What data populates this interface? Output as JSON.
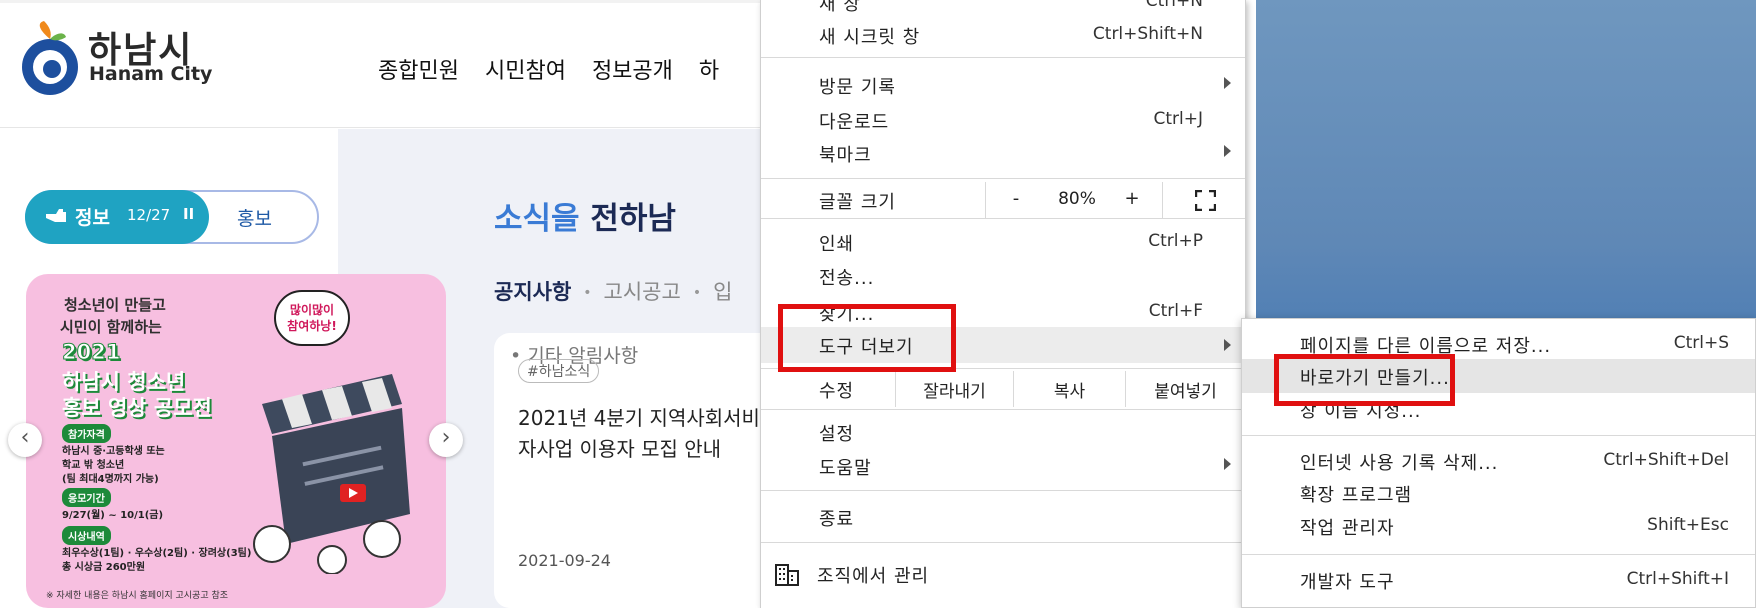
{
  "site": {
    "logo_name": "하남시",
    "logo_en": "Hanam City",
    "nav": [
      "종합민원",
      "시민참여",
      "정보공개",
      "하"
    ],
    "toggle": {
      "active_label": "정보",
      "counter": "12/27",
      "pause": "II",
      "inactive_label": "홍보"
    },
    "banner": {
      "title1": "청소년이 만들고",
      "title2": "시민이 함께하는",
      "year": "2021",
      "main1": "하남시 청소년",
      "main2": "홍보 영상 공모전",
      "bubble": "많이많이\n참여하낭!",
      "tag1": "참가자격",
      "line1": "하남시 중·고등학생 또는",
      "line2": "학교 밖 청소년",
      "line3": "(팀 최대4명까지 가능)",
      "tag2": "응모기간",
      "line4": "9/27(월) ~ 10/1(금)",
      "tag3": "시상내역",
      "line5": "최우수상(1팀) · 우수상(2팀) · 장려상(3팀)",
      "line6": "총 시상금 260만원",
      "note": "※ 자세한 내용은 하남시 홈페이지 고시공고 참조"
    },
    "news": {
      "title_accent": "소식을",
      "title_rest": " 전하남",
      "tabs": [
        "공지사항",
        "고시공고",
        "입"
      ],
      "card": {
        "category": "기타 알림사항",
        "tag": "#하남소식",
        "text": "2021년 4분기 지역사회서비 자사업 이용자 모집 안내",
        "date": "2021-09-24"
      }
    }
  },
  "menu": {
    "new_window": "새 창",
    "new_window_sc": "Ctrl+N",
    "incognito": "새 시크릿 창",
    "incognito_sc": "Ctrl+Shift+N",
    "history": "방문 기록",
    "downloads": "다운로드",
    "downloads_sc": "Ctrl+J",
    "bookmarks": "북마크",
    "font_size": "글꼴 크기",
    "zoom_minus": "-",
    "zoom_value": "80%",
    "zoom_plus": "+",
    "print": "인쇄",
    "print_sc": "Ctrl+P",
    "cast": "전송...",
    "find": "찾기...",
    "find_sc": "Ctrl+F",
    "more_tools": "도구 더보기",
    "edit": "수정",
    "cut": "잘라내기",
    "copy": "복사",
    "paste": "붙여넣기",
    "settings": "설정",
    "help": "도움말",
    "exit": "종료",
    "managed": "조직에서 관리"
  },
  "submenu": {
    "save_as": "페이지를 다른 이름으로 저장...",
    "save_as_sc": "Ctrl+S",
    "create_shortcut": "바로가기 만들기...",
    "name_window": "창 이름 지정...",
    "clear_data": "인터넷 사용 기록 삭제...",
    "clear_data_sc": "Ctrl+Shift+Del",
    "extensions": "확장 프로그램",
    "task_manager": "작업 관리자",
    "task_manager_sc": "Shift+Esc",
    "dev_tools": "개발자 도구",
    "dev_tools_sc": "Ctrl+Shift+I"
  },
  "colors": {
    "highlight_red": "#e01010",
    "accent_teal": "#1fa3c2",
    "brand_navy": "#1c2a55",
    "menu_hover": "#ececec"
  }
}
